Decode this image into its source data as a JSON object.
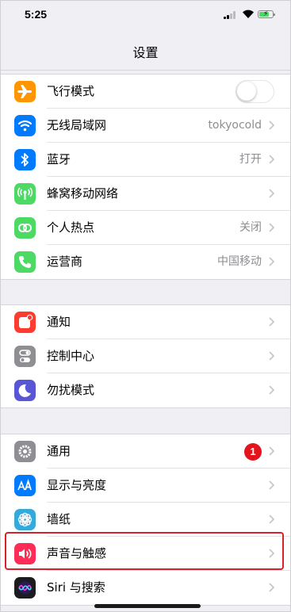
{
  "status_bar": {
    "time": "5:25"
  },
  "nav": {
    "title": "设置"
  },
  "groups": [
    [
      {
        "label": "飞行模式",
        "icon": "airplane-icon",
        "color": "#ff9500",
        "control": "toggle",
        "toggle_on": false
      },
      {
        "label": "无线局域网",
        "value": "tokyocold",
        "icon": "wifi-icon",
        "color": "#007aff"
      },
      {
        "label": "蓝牙",
        "value": "打开",
        "icon": "bluetooth-icon",
        "color": "#007aff"
      },
      {
        "label": "蜂窝移动网络",
        "icon": "cellular-antenna-icon",
        "color": "#4cd964"
      },
      {
        "label": "个人热点",
        "value": "关闭",
        "icon": "hotspot-link-icon",
        "color": "#4cd964"
      },
      {
        "label": "运营商",
        "value": "中国移动",
        "icon": "phone-icon",
        "color": "#4cd964"
      }
    ],
    [
      {
        "label": "通知",
        "icon": "notification-icon",
        "color": "#ff3b30"
      },
      {
        "label": "控制中心",
        "icon": "control-center-icon",
        "color": "#8e8e93"
      },
      {
        "label": "勿扰模式",
        "icon": "moon-icon",
        "color": "#5856d6"
      }
    ],
    [
      {
        "label": "通用",
        "badge": "1",
        "icon": "gear-icon",
        "color": "#8e8e93"
      },
      {
        "label": "显示与亮度",
        "icon": "text-size-icon",
        "color": "#007aff"
      },
      {
        "label": "墙纸",
        "icon": "flower-icon",
        "color": "#34aadc"
      },
      {
        "label": "声音与触感",
        "icon": "speaker-icon",
        "color": "#ff2d55"
      },
      {
        "label": "Siri 与搜索",
        "icon": "siri-icon",
        "color": "#1c1c1e"
      }
    ]
  ]
}
